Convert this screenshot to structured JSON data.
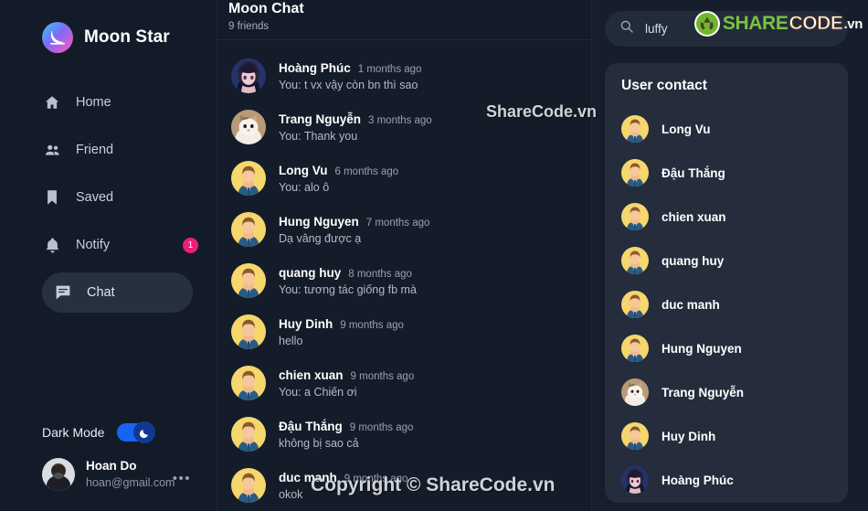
{
  "brand": {
    "name": "Moon Star",
    "logo_icon": "moon-crescent-icon",
    "gradient": [
      "#31c9f0",
      "#7b6cf6",
      "#d65fd0",
      "#f06fb0"
    ]
  },
  "sidebar": {
    "items": [
      {
        "label": "Home",
        "icon": "home-icon",
        "active": false,
        "badge": null
      },
      {
        "label": "Friend",
        "icon": "people-icon",
        "active": false,
        "badge": null
      },
      {
        "label": "Saved",
        "icon": "bookmark-icon",
        "active": false,
        "badge": null
      },
      {
        "label": "Notify",
        "icon": "bell-icon",
        "active": false,
        "badge": "1"
      },
      {
        "label": "Chat",
        "icon": "chat-bubble-icon",
        "active": true,
        "badge": null
      }
    ],
    "badge_color": "#ec1e79",
    "active_bg": "#27303f",
    "dark_mode": {
      "label": "Dark Mode",
      "on": true,
      "knob_icon": "moon-icon",
      "track_color": "#1565f0"
    },
    "profile": {
      "name": "Hoan Do",
      "email": "hoan@gmail.com",
      "avatar": "photo-person-mask",
      "more_icon": "more-dots-icon"
    }
  },
  "chat_panel": {
    "title": "Moon Chat",
    "subtitle": "9 friends",
    "rows": [
      {
        "name": "Hoàng Phúc",
        "time": "1 months ago",
        "preview": "You: t vx vậy còn bn thì sao",
        "avatar": "anime"
      },
      {
        "name": "Trang Nguyễn",
        "time": "3 months ago",
        "preview": "You: Thank you",
        "avatar": "cat"
      },
      {
        "name": "Long Vu",
        "time": "6 months ago",
        "preview": "You: alo ô",
        "avatar": "default"
      },
      {
        "name": "Hung Nguyen",
        "time": "7 months ago",
        "preview": "Dạ vâng được ạ",
        "avatar": "default"
      },
      {
        "name": "quang huy",
        "time": "8 months ago",
        "preview": "You: tương tác giống fb mà",
        "avatar": "default"
      },
      {
        "name": "Huy Dinh",
        "time": "9 months ago",
        "preview": "hello",
        "avatar": "default"
      },
      {
        "name": "chien xuan",
        "time": "9 months ago",
        "preview": "You: a Chiến ơi",
        "avatar": "default"
      },
      {
        "name": "Đậu Thắng",
        "time": "9 months ago",
        "preview": "không bị sao cả",
        "avatar": "default"
      },
      {
        "name": "duc manh",
        "time": "9 months ago",
        "preview": "okok",
        "avatar": "default"
      }
    ]
  },
  "right_panel": {
    "search": {
      "value": "luffy",
      "placeholder": "Search",
      "icon": "search-icon"
    },
    "contacts_title": "User contact",
    "contacts": [
      {
        "name": "Long Vu",
        "avatar": "default"
      },
      {
        "name": "Đậu Thắng",
        "avatar": "default"
      },
      {
        "name": "chien xuan",
        "avatar": "default"
      },
      {
        "name": "quang huy",
        "avatar": "default"
      },
      {
        "name": "duc manh",
        "avatar": "default"
      },
      {
        "name": "Hung Nguyen",
        "avatar": "default"
      },
      {
        "name": "Trang Nguyễn",
        "avatar": "cat"
      },
      {
        "name": "Huy Dinh",
        "avatar": "default"
      },
      {
        "name": "Hoàng Phúc",
        "avatar": "anime"
      }
    ]
  },
  "watermarks": {
    "middle": "ShareCode.vn",
    "bottom": "Copyright © ShareCode.vn",
    "logo": {
      "share": "SHARE",
      "code": "CODE",
      "tld": ".vn",
      "mark_icon": "sharecode-recycle-icon"
    }
  }
}
